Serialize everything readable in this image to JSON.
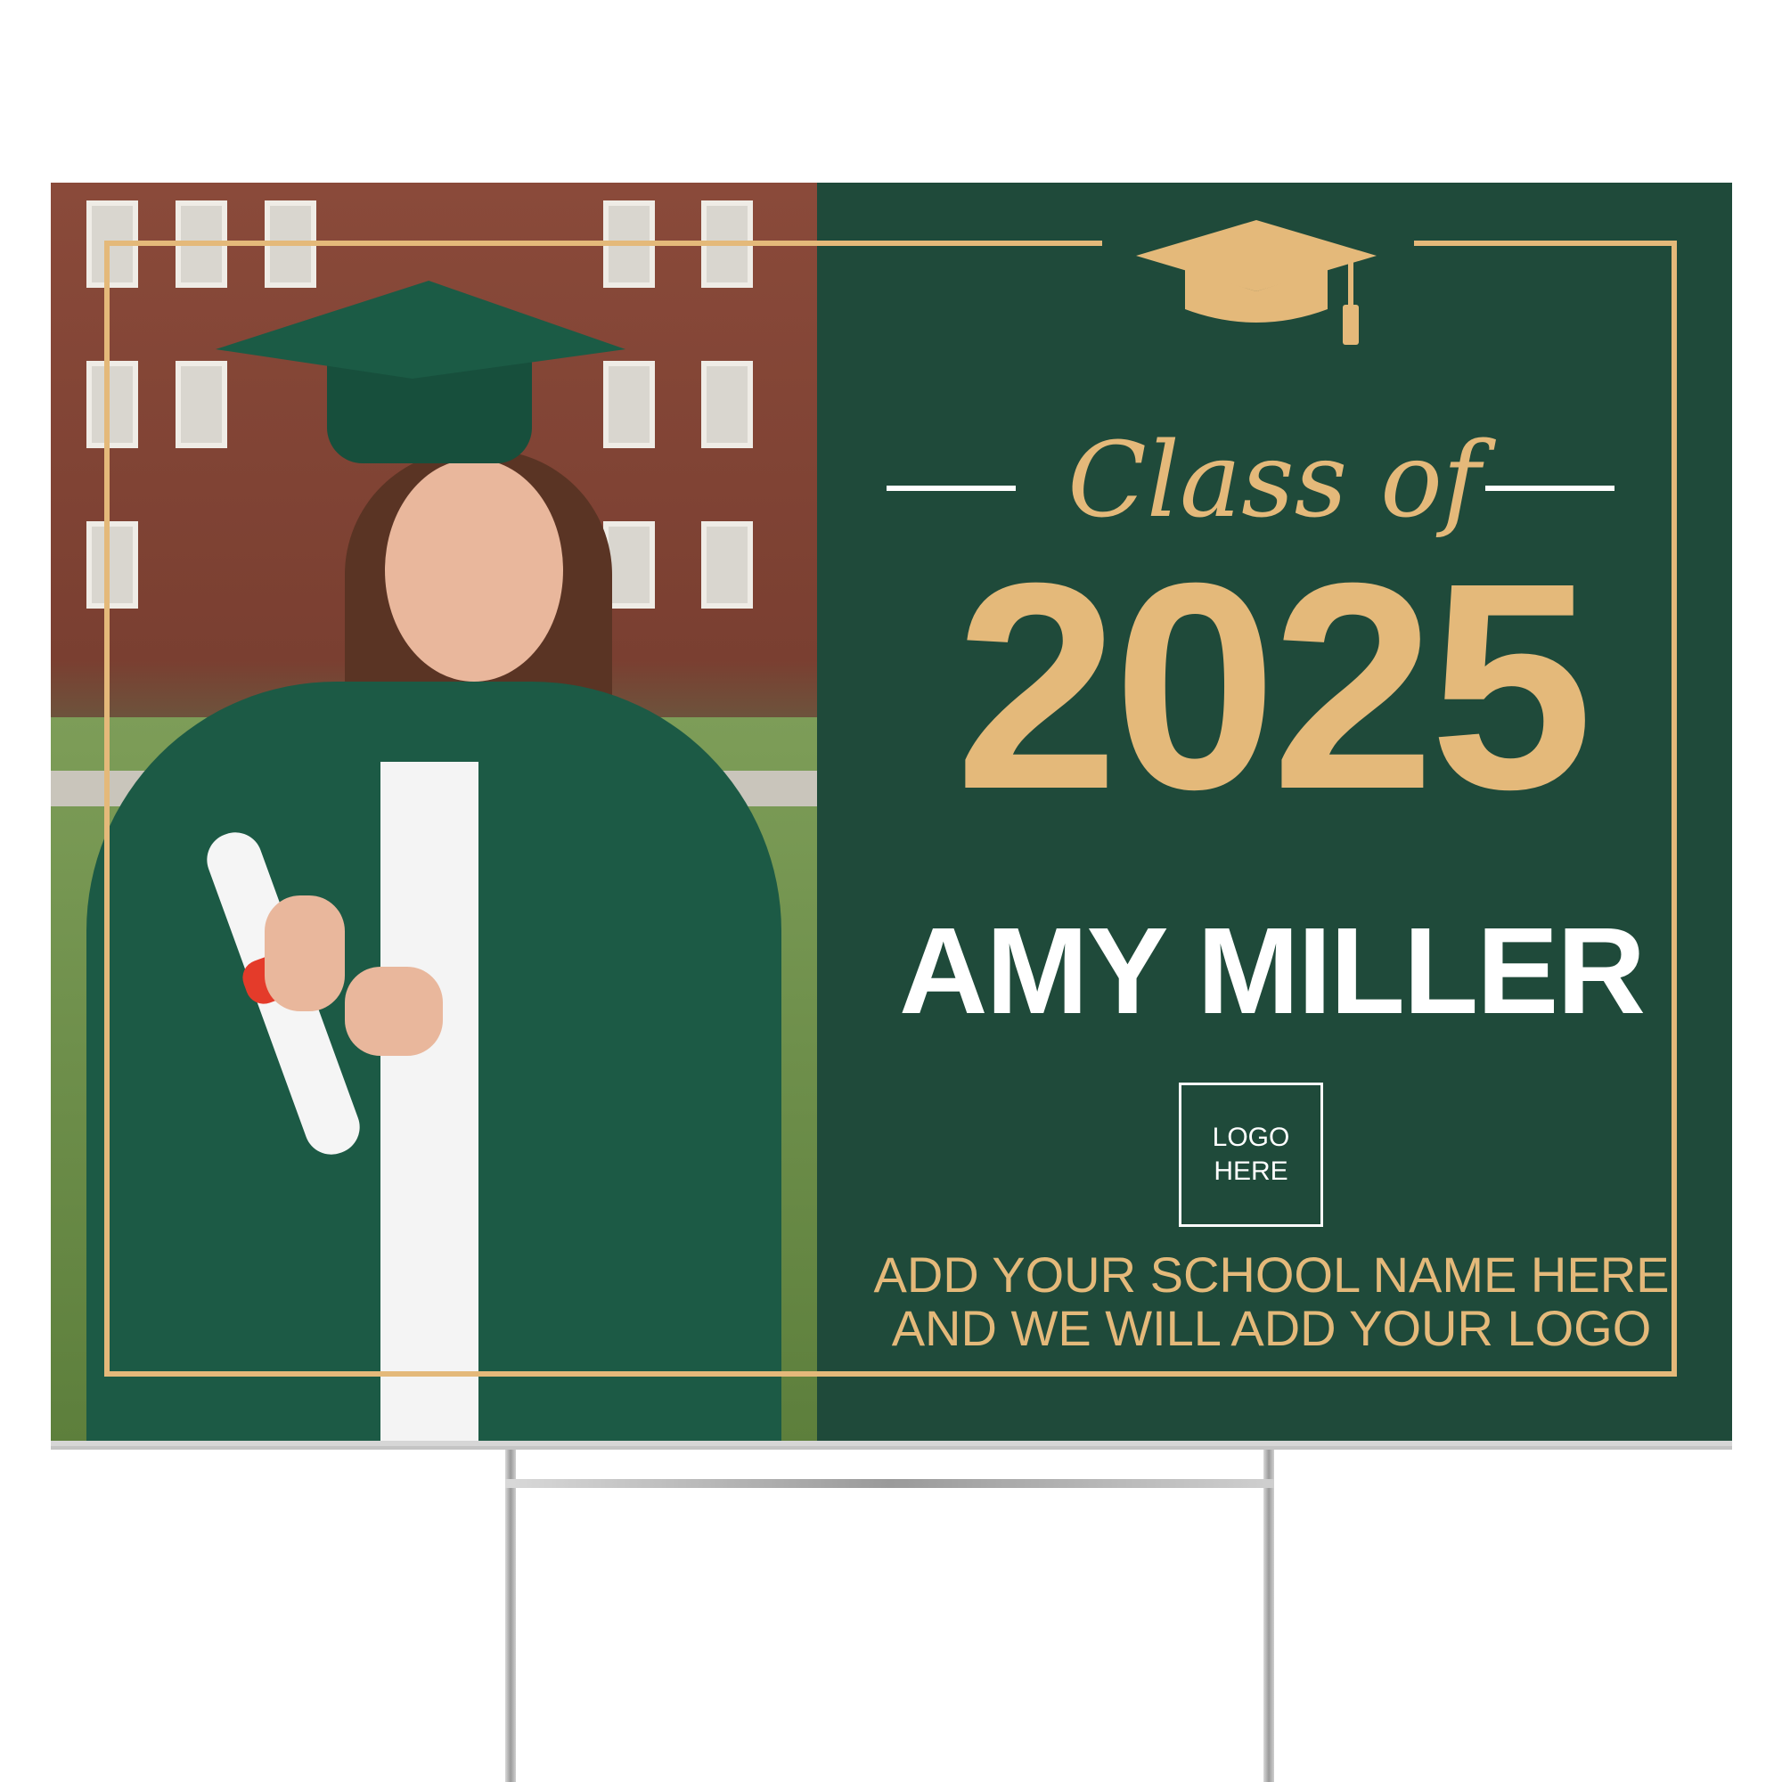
{
  "sign": {
    "script_heading": "Class of",
    "year": "2025",
    "graduate_name": "AMY MILLER",
    "logo_placeholder": [
      "LOGO",
      "HERE"
    ],
    "school_lines": [
      "ADD YOUR SCHOOL NAME HERE",
      "AND WE WILL ADD YOUR LOGO"
    ]
  },
  "colors": {
    "panel_green": "#1f4a3a",
    "gold": "#e4b97a",
    "name_white": "#ffffff",
    "gown_green": "#1c5a45"
  },
  "icons": [
    "graduation-cap-icon"
  ],
  "photo": {
    "subject": "graduate-photo"
  }
}
